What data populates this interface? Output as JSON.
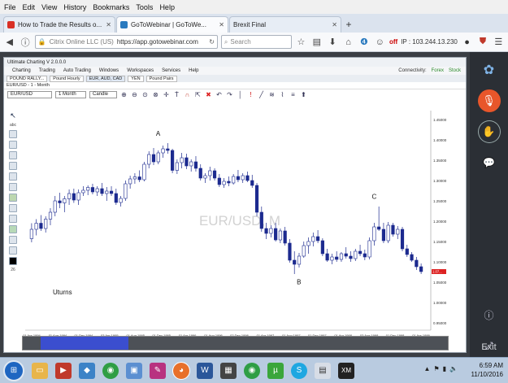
{
  "menubar": [
    "File",
    "Edit",
    "View",
    "History",
    "Bookmarks",
    "Tools",
    "Help"
  ],
  "tabs": [
    {
      "title": "How to Trade the Results o...",
      "color": "#d93025",
      "active": false
    },
    {
      "title": "GoToWebinar | GoToWe...",
      "color": "#2a7abf",
      "active": true
    },
    {
      "title": "Brexit Final",
      "color": "#e7edf5",
      "active": false
    }
  ],
  "nav": {
    "site_label": "Citrix Online LLC (US)",
    "url": "https://app.gotowebinar.com",
    "search_placeholder": "Search",
    "off_label": "off",
    "ip_label": "IP : 103.244.13.230"
  },
  "app": {
    "title": "Ultimate Charting V 2.0.0.0",
    "menu": [
      "Charting",
      "Trading",
      "Auto Trading",
      "Windows",
      "Workspaces",
      "Services",
      "Help"
    ],
    "status": [
      "Connectivity:",
      "Forex",
      "Stock"
    ],
    "tabs": [
      "POUND RALLY...",
      "Pound Hourly",
      "EUR, AUD, CAD",
      "YEN",
      "Pound Pairs"
    ],
    "chart_window_title": "EUR/USD - 1 - Month",
    "toolbar": {
      "symbol": "EUR/USD",
      "period": "1 Month",
      "style": "Candle"
    },
    "watermark": "EUR/USD, M",
    "note": "Uturns",
    "labels": {
      "a": "A",
      "b": "B",
      "c": "C"
    },
    "left_value": "26"
  },
  "chart_data": {
    "type": "candlestick",
    "symbol": "EUR/USD",
    "y_ticks": [
      "1.45000",
      "1.40000",
      "1.35000",
      "1.30000",
      "1.25000",
      "1.20000",
      "1.15000",
      "1.10000",
      "1.05000",
      "1.00000",
      "0.95000"
    ],
    "current_price_label": "1.07...",
    "x_ticks": [
      "01 Apr 1994",
      "01 Aug 1994",
      "01 Dec 1994",
      "03 Apr 1995",
      "01 Aug 1995",
      "01 Dec 1995",
      "01 Apr 1996",
      "01 Aug 1996",
      "02 Dec 1996",
      "01 Apr 1997",
      "01 Aug 1997",
      "01 Dec 1997",
      "01 Apr 1998",
      "03 Aug 1998",
      "01 Dec 1998",
      "01 Apr 1999"
    ],
    "candles": [
      {
        "o": 1.157,
        "h": 1.195,
        "l": 1.148,
        "c": 1.18
      },
      {
        "o": 1.18,
        "h": 1.205,
        "l": 1.165,
        "c": 1.195
      },
      {
        "o": 1.195,
        "h": 1.215,
        "l": 1.176,
        "c": 1.182
      },
      {
        "o": 1.182,
        "h": 1.212,
        "l": 1.172,
        "c": 1.205
      },
      {
        "o": 1.205,
        "h": 1.232,
        "l": 1.19,
        "c": 1.222
      },
      {
        "o": 1.222,
        "h": 1.262,
        "l": 1.212,
        "c": 1.25
      },
      {
        "o": 1.25,
        "h": 1.27,
        "l": 1.232,
        "c": 1.245
      },
      {
        "o": 1.245,
        "h": 1.262,
        "l": 1.222,
        "c": 1.255
      },
      {
        "o": 1.255,
        "h": 1.278,
        "l": 1.24,
        "c": 1.268
      },
      {
        "o": 1.268,
        "h": 1.28,
        "l": 1.245,
        "c": 1.252
      },
      {
        "o": 1.252,
        "h": 1.278,
        "l": 1.24,
        "c": 1.27
      },
      {
        "o": 1.27,
        "h": 1.286,
        "l": 1.262,
        "c": 1.276
      },
      {
        "o": 1.276,
        "h": 1.288,
        "l": 1.264,
        "c": 1.283
      },
      {
        "o": 1.283,
        "h": 1.292,
        "l": 1.266,
        "c": 1.272
      },
      {
        "o": 1.272,
        "h": 1.286,
        "l": 1.262,
        "c": 1.28
      },
      {
        "o": 1.28,
        "h": 1.294,
        "l": 1.262,
        "c": 1.268
      },
      {
        "o": 1.268,
        "h": 1.284,
        "l": 1.25,
        "c": 1.274
      },
      {
        "o": 1.274,
        "h": 1.286,
        "l": 1.262,
        "c": 1.268
      },
      {
        "o": 1.268,
        "h": 1.28,
        "l": 1.24,
        "c": 1.246
      },
      {
        "o": 1.246,
        "h": 1.262,
        "l": 1.236,
        "c": 1.256
      },
      {
        "o": 1.256,
        "h": 1.3,
        "l": 1.25,
        "c": 1.292
      },
      {
        "o": 1.292,
        "h": 1.312,
        "l": 1.28,
        "c": 1.304
      },
      {
        "o": 1.304,
        "h": 1.318,
        "l": 1.292,
        "c": 1.309
      },
      {
        "o": 1.309,
        "h": 1.325,
        "l": 1.296,
        "c": 1.302
      },
      {
        "o": 1.302,
        "h": 1.346,
        "l": 1.298,
        "c": 1.34
      },
      {
        "o": 1.34,
        "h": 1.372,
        "l": 1.33,
        "c": 1.364
      },
      {
        "o": 1.364,
        "h": 1.38,
        "l": 1.338,
        "c": 1.346
      },
      {
        "o": 1.346,
        "h": 1.374,
        "l": 1.34,
        "c": 1.368
      },
      {
        "o": 1.368,
        "h": 1.386,
        "l": 1.356,
        "c": 1.378
      },
      {
        "o": 1.378,
        "h": 1.392,
        "l": 1.366,
        "c": 1.374
      },
      {
        "o": 1.374,
        "h": 1.378,
        "l": 1.318,
        "c": 1.325
      },
      {
        "o": 1.325,
        "h": 1.352,
        "l": 1.316,
        "c": 1.344
      },
      {
        "o": 1.344,
        "h": 1.368,
        "l": 1.33,
        "c": 1.356
      },
      {
        "o": 1.356,
        "h": 1.366,
        "l": 1.328,
        "c": 1.336
      },
      {
        "o": 1.336,
        "h": 1.352,
        "l": 1.322,
        "c": 1.346
      },
      {
        "o": 1.346,
        "h": 1.36,
        "l": 1.322,
        "c": 1.33
      },
      {
        "o": 1.33,
        "h": 1.34,
        "l": 1.3,
        "c": 1.306
      },
      {
        "o": 1.306,
        "h": 1.318,
        "l": 1.294,
        "c": 1.312
      },
      {
        "o": 1.312,
        "h": 1.334,
        "l": 1.3,
        "c": 1.324
      },
      {
        "o": 1.324,
        "h": 1.33,
        "l": 1.3,
        "c": 1.306
      },
      {
        "o": 1.306,
        "h": 1.316,
        "l": 1.284,
        "c": 1.29
      },
      {
        "o": 1.29,
        "h": 1.306,
        "l": 1.282,
        "c": 1.298
      },
      {
        "o": 1.298,
        "h": 1.31,
        "l": 1.286,
        "c": 1.294
      },
      {
        "o": 1.294,
        "h": 1.316,
        "l": 1.29,
        "c": 1.31
      },
      {
        "o": 1.31,
        "h": 1.326,
        "l": 1.296,
        "c": 1.302
      },
      {
        "o": 1.302,
        "h": 1.318,
        "l": 1.294,
        "c": 1.312
      },
      {
        "o": 1.312,
        "h": 1.322,
        "l": 1.296,
        "c": 1.3
      },
      {
        "o": 1.3,
        "h": 1.314,
        "l": 1.282,
        "c": 1.288
      },
      {
        "o": 1.288,
        "h": 1.294,
        "l": 1.212,
        "c": 1.222
      },
      {
        "o": 1.222,
        "h": 1.236,
        "l": 1.174,
        "c": 1.182
      },
      {
        "o": 1.182,
        "h": 1.196,
        "l": 1.156,
        "c": 1.17
      },
      {
        "o": 1.17,
        "h": 1.19,
        "l": 1.16,
        "c": 1.182
      },
      {
        "o": 1.182,
        "h": 1.196,
        "l": 1.15,
        "c": 1.154
      },
      {
        "o": 1.154,
        "h": 1.182,
        "l": 1.146,
        "c": 1.176
      },
      {
        "o": 1.176,
        "h": 1.186,
        "l": 1.14,
        "c": 1.146
      },
      {
        "o": 1.146,
        "h": 1.156,
        "l": 1.098,
        "c": 1.104
      },
      {
        "o": 1.104,
        "h": 1.126,
        "l": 1.07,
        "c": 1.094
      },
      {
        "o": 1.094,
        "h": 1.122,
        "l": 1.086,
        "c": 1.114
      },
      {
        "o": 1.114,
        "h": 1.15,
        "l": 1.11,
        "c": 1.14
      },
      {
        "o": 1.14,
        "h": 1.16,
        "l": 1.12,
        "c": 1.15
      },
      {
        "o": 1.15,
        "h": 1.172,
        "l": 1.138,
        "c": 1.162
      },
      {
        "o": 1.162,
        "h": 1.178,
        "l": 1.146,
        "c": 1.152
      },
      {
        "o": 1.152,
        "h": 1.158,
        "l": 1.114,
        "c": 1.12
      },
      {
        "o": 1.12,
        "h": 1.132,
        "l": 1.1,
        "c": 1.104
      },
      {
        "o": 1.104,
        "h": 1.12,
        "l": 1.094,
        "c": 1.112
      },
      {
        "o": 1.112,
        "h": 1.126,
        "l": 1.1,
        "c": 1.106
      },
      {
        "o": 1.106,
        "h": 1.124,
        "l": 1.1,
        "c": 1.12
      },
      {
        "o": 1.12,
        "h": 1.136,
        "l": 1.108,
        "c": 1.114
      },
      {
        "o": 1.114,
        "h": 1.126,
        "l": 1.1,
        "c": 1.108
      },
      {
        "o": 1.108,
        "h": 1.132,
        "l": 1.102,
        "c": 1.126
      },
      {
        "o": 1.126,
        "h": 1.142,
        "l": 1.114,
        "c": 1.12
      },
      {
        "o": 1.12,
        "h": 1.13,
        "l": 1.104,
        "c": 1.112
      },
      {
        "o": 1.112,
        "h": 1.16,
        "l": 1.106,
        "c": 1.152
      },
      {
        "o": 1.152,
        "h": 1.196,
        "l": 1.14,
        "c": 1.186
      },
      {
        "o": 1.186,
        "h": 1.236,
        "l": 1.176,
        "c": 1.18
      },
      {
        "o": 1.18,
        "h": 1.196,
        "l": 1.146,
        "c": 1.152
      },
      {
        "o": 1.152,
        "h": 1.198,
        "l": 1.146,
        "c": 1.19
      },
      {
        "o": 1.19,
        "h": 1.196,
        "l": 1.162,
        "c": 1.168
      },
      {
        "o": 1.168,
        "h": 1.188,
        "l": 1.156,
        "c": 1.18
      },
      {
        "o": 1.18,
        "h": 1.186,
        "l": 1.126,
        "c": 1.132
      },
      {
        "o": 1.132,
        "h": 1.142,
        "l": 1.112,
        "c": 1.118
      },
      {
        "o": 1.118,
        "h": 1.124,
        "l": 1.1,
        "c": 1.104
      },
      {
        "o": 1.104,
        "h": 1.112,
        "l": 1.08,
        "c": 1.088
      },
      {
        "o": 1.088,
        "h": 1.096,
        "l": 1.07,
        "c": 1.076
      }
    ]
  },
  "gtw": [
    "logo",
    "mic-muted",
    "raise-hand",
    "chat",
    "info",
    "expand"
  ],
  "gtw_exit": "Exit",
  "taskbar": {
    "items": [
      {
        "name": "start",
        "color": "#1f66c1"
      },
      {
        "name": "folder",
        "color": "#e8b54a"
      },
      {
        "name": "media",
        "color": "#c0392b"
      },
      {
        "name": "app-blue",
        "color": "#3c83c7"
      },
      {
        "name": "chrome",
        "color": "#2f9e44"
      },
      {
        "name": "app-blue-2",
        "color": "#5b8fd1"
      },
      {
        "name": "pen",
        "color": "#b83280"
      },
      {
        "name": "firefox",
        "color": "#e8702a"
      },
      {
        "name": "word",
        "color": "#2b579a"
      },
      {
        "name": "chart-app",
        "color": "#444"
      },
      {
        "name": "chrome-2",
        "color": "#2f9e44"
      },
      {
        "name": "utorrent",
        "color": "#3aa63a"
      },
      {
        "name": "skype",
        "color": "#1ea7e1"
      },
      {
        "name": "paper",
        "color": "#d7dde6"
      },
      {
        "name": "xm",
        "color": "#222"
      }
    ],
    "time": "6:59 AM",
    "date": "11/10/2016"
  }
}
